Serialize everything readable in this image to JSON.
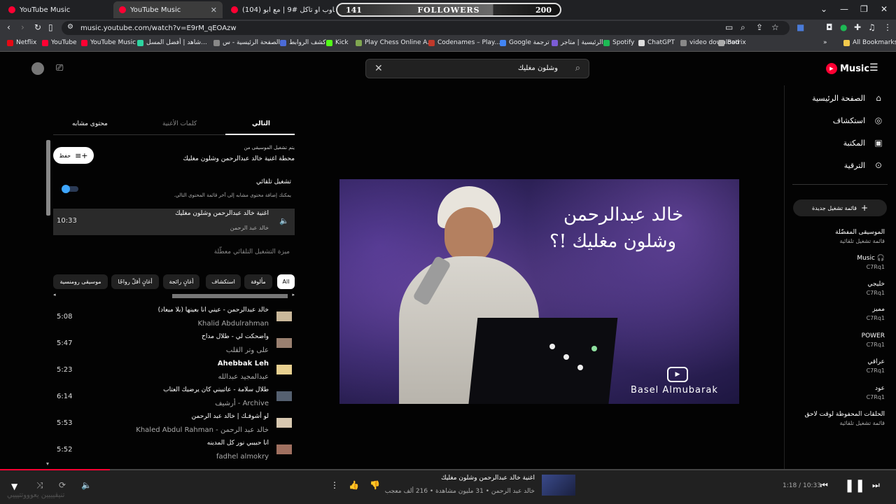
{
  "browser": {
    "tabs": [
      {
        "title": "YouTube Music"
      },
      {
        "title": "YouTube Music"
      },
      {
        "title": "(104) تجاوب او تاكل #9 | مع ابو ..."
      }
    ],
    "followers": {
      "left": "141",
      "label": "FOLLOWERS",
      "right": "200"
    },
    "url": "music.youtube.com/watch?v=E9rM_qEOAzw",
    "bookmarks": [
      {
        "label": "Netflix",
        "color": "#e50914"
      },
      {
        "label": "YouTube",
        "color": "#ff0033"
      },
      {
        "label": "YouTube Music",
        "color": "#ff0033"
      },
      {
        "label": "شاهد | أفضل المسل...",
        "color": "#2dd4a0"
      },
      {
        "label": "الصفحة الرئيسية - س...",
        "color": "#888888"
      },
      {
        "label": "كشف الروابط",
        "color": "#4b6bd8"
      },
      {
        "label": "Kick",
        "color": "#53fc18"
      },
      {
        "label": "Play Chess Online A...",
        "color": "#7fa650"
      },
      {
        "label": "Codenames – Play...",
        "color": "#c0392b"
      },
      {
        "label": "Google ترجمة",
        "color": "#4285f4"
      },
      {
        "label": "الرئيسية | متاجر",
        "color": "#7b5cd6"
      },
      {
        "label": "Spotify",
        "color": "#1db954"
      },
      {
        "label": "ChatGPT",
        "color": "#dddddd"
      },
      {
        "label": "video download",
        "color": "#888888"
      },
      {
        "label": "Botrix",
        "color": "#aaaaaa"
      }
    ],
    "all_bookmarks": "All Bookmarks"
  },
  "header": {
    "logo": "Music",
    "search_value": "وشلون مغليك"
  },
  "sidebar": {
    "nav": [
      {
        "label": "الصفحة الرئيسية",
        "icon": "home-icon"
      },
      {
        "label": "استكشاف",
        "icon": "explore-icon"
      },
      {
        "label": "المكتبة",
        "icon": "library-icon"
      },
      {
        "label": "الترقية",
        "icon": "upgrade-icon"
      }
    ],
    "new_playlist": "قائمة تشغيل جديدة",
    "playlists": [
      {
        "title": "الموسيقى المفضّلة",
        "sub": "قائمة تشغيل تلقائية"
      },
      {
        "title": "Music 🎧",
        "sub": "C7Rq1"
      },
      {
        "title": "خليجي",
        "sub": "C7Rq1"
      },
      {
        "title": "مميز",
        "sub": "C7Rq1"
      },
      {
        "title": "POWER",
        "sub": "C7Rq1"
      },
      {
        "title": "عراقي",
        "sub": "C7Rq1"
      },
      {
        "title": "عود",
        "sub": "C7Rq1"
      },
      {
        "title": "الحلقات المحفوظة لوقت لاحق",
        "sub": "قائمة تشغيل تلقائية"
      }
    ]
  },
  "video": {
    "overlay_line1": "خالد عبدالرحمن",
    "overlay_line2": "وشلون مغليك !؟",
    "watermark": "Basel Almubarak"
  },
  "queue_panel": {
    "tabs": {
      "next": "التالي",
      "lyrics": "كلمات الأغنية",
      "related": "محتوى مشابه"
    },
    "playing_from_label": "يتم تشغيل الموسيقى من",
    "playing_from_value": "محطة اغنية خالد عبدالرحمن وشلون مغليك",
    "save_label": "حفظ",
    "autoplay_title": "تشغيل تلقائي",
    "autoplay_desc": "يمكنك إضافة محتوى مشابه إلى آخر قائمة المحتوى التالي.",
    "current": {
      "title": "اغنية خالد عبدالرحمن وشلون مغليك",
      "artist": "خالد عبد الرحمن",
      "duration": "10:33"
    },
    "autoplay_disabled": "ميزة التشغيل التلقائي معطّلة",
    "chips": [
      "All",
      "مألوفة",
      "استكشاف",
      "أغانٍ رائجة",
      "أغانٍ أقلّ رواجًا",
      "موسيقى رومنسية"
    ],
    "rows": [
      {
        "title": "خالد عبدالرحمن - عيني انا بعينها (بلا ميعاد)",
        "artist": "Khalid Abdulrahman",
        "duration": "5:08"
      },
      {
        "title": "واضحكت لي - طلال مداح",
        "artist": "على وتر القلب",
        "duration": "5:47"
      },
      {
        "title": "Ahebbak Leh",
        "artist": "عبدالمجيد عبدالله",
        "duration": "5:23"
      },
      {
        "title": "طلال سلامة - عاتبيني كان يرضيك العتاب",
        "artist": "أرشيف - Archive",
        "duration": "6:14"
      },
      {
        "title": "لو أشوفـك | خالد عبد الرحمن",
        "artist": "Khaled Abdul Rahman - خالد عبد الرحمن",
        "duration": "5:53"
      },
      {
        "title": "انا حبيبي نور كل المدينه",
        "artist": "fadhel almokry",
        "duration": "5:52"
      }
    ]
  },
  "player": {
    "title": "اغنية خالد عبدالرحمن وشلون مغليك",
    "meta": "خالد عبد الرحمن • 31 مليون مشاهدة • 216 ألف معجب",
    "time": "1:18 / 10:33",
    "progress": 0.123
  },
  "overlay_text": "تنيقيييين يعوووتتيييي"
}
